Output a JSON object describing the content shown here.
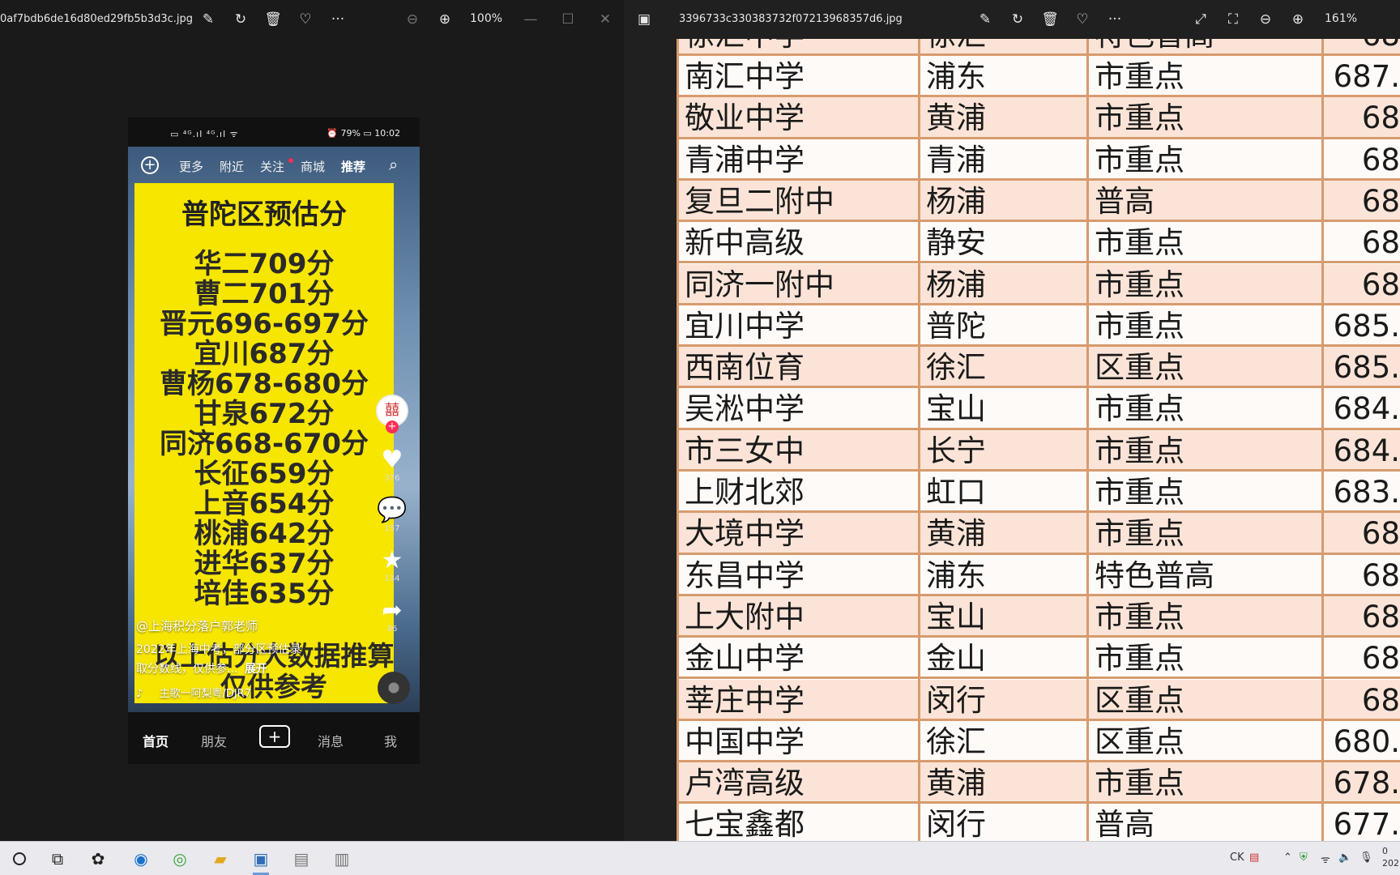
{
  "left_window": {
    "filename": "0af7bdb6de16d80ed29fb5b3d3c.jpg",
    "zoom": "100%"
  },
  "right_window": {
    "filename": "3396733c330383732f07213968357d6.jpg",
    "zoom": "161%"
  },
  "phone": {
    "status": {
      "left": "▭ ⁴ᴳ.ıl ⁴ᴳ.ıl ᯤ",
      "right": "⏰ 79% ▭ 10:02"
    },
    "top_nav": [
      "更多",
      "附近",
      "关注",
      "商城",
      "推荐"
    ],
    "video_title": "普陀区预估分",
    "score_lines": [
      "华二709分",
      "曹二701分",
      "晋元696-697分",
      "宜川687分",
      "曹杨678-680分",
      "甘泉672分",
      "同济668-670分",
      "长征659分",
      "上音654分",
      "桃浦642分",
      "进华637分",
      "培佳635分"
    ],
    "side_counts": {
      "like": "376",
      "comment": "157",
      "favorite": "134",
      "share": "86"
    },
    "author": "@上海积分落户郭老师",
    "desc_line1": "2022年上海中考，部分区预估录",
    "desc_line2": "取分数线，仅供参...",
    "expand": "展开",
    "big_caption_1": "以上估分大数据推算",
    "big_caption_2": "仅供参考",
    "music": "主歌一阿梨粤/DJR7",
    "bottom_nav": [
      "首页",
      "朋友",
      "+",
      "消息",
      "我"
    ]
  },
  "table": {
    "top_partial": [
      "徐汇中学",
      "徐汇",
      "特色普高",
      "68"
    ],
    "rows": [
      [
        "南汇中学",
        "浦东",
        "市重点",
        "687."
      ],
      [
        "敬业中学",
        "黄浦",
        "市重点",
        "68"
      ],
      [
        "青浦中学",
        "青浦",
        "市重点",
        "68"
      ],
      [
        "复旦二附中",
        "杨浦",
        "普高",
        "68"
      ],
      [
        "新中高级",
        "静安",
        "市重点",
        "68"
      ],
      [
        "同济一附中",
        "杨浦",
        "市重点",
        "68"
      ],
      [
        "宜川中学",
        "普陀",
        "市重点",
        "685."
      ],
      [
        "西南位育",
        "徐汇",
        "区重点",
        "685."
      ],
      [
        "吴淞中学",
        "宝山",
        "市重点",
        "684."
      ],
      [
        "市三女中",
        "长宁",
        "市重点",
        "684."
      ],
      [
        "上财北郊",
        "虹口",
        "市重点",
        "683."
      ],
      [
        "大境中学",
        "黄浦",
        "市重点",
        "68"
      ],
      [
        "东昌中学",
        "浦东",
        "特色普高",
        "68"
      ],
      [
        "上大附中",
        "宝山",
        "市重点",
        "68"
      ],
      [
        "金山中学",
        "金山",
        "市重点",
        "68"
      ],
      [
        "莘庄中学",
        "闵行",
        "区重点",
        "68"
      ],
      [
        "中国中学",
        "徐汇",
        "区重点",
        "680."
      ],
      [
        "卢湾高级",
        "黄浦",
        "市重点",
        "678."
      ],
      [
        "七宝鑫都",
        "闵行",
        "普高",
        "677."
      ]
    ]
  },
  "taskbar": {
    "tray_text": "CK",
    "clock": "0\n202"
  }
}
